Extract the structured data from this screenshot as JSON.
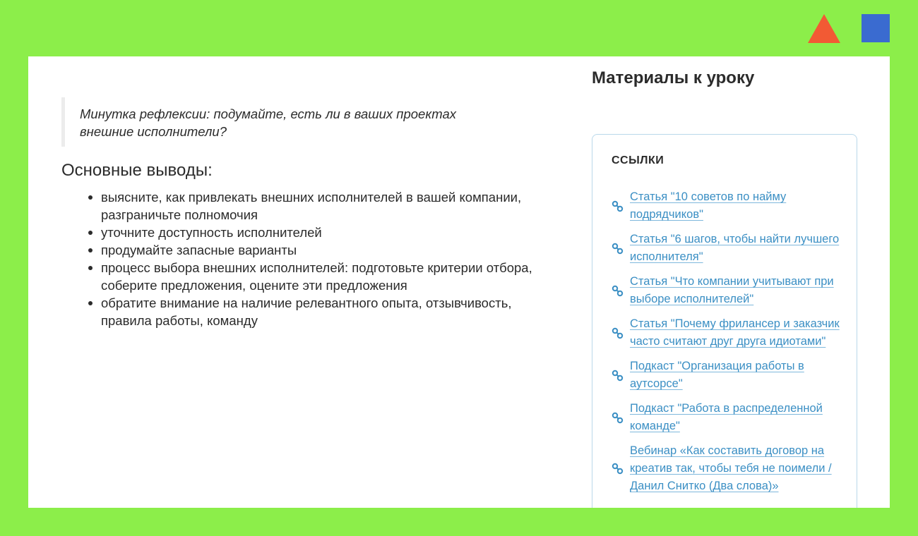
{
  "quote": {
    "text": "Минутка рефлексии: подумайте, есть ли в ваших проектах внешние исполнители?"
  },
  "conclusions": {
    "title": "Основные выводы:",
    "items": [
      "выясните, как привлекать внешних исполнителей в вашей компании, разграничьте полномочия",
      "уточните доступность исполнителей",
      "продумайте запасные варианты",
      "процесс выбора внешних исполнителей: подготовьте критерии отбора, соберите предложения, оцените эти предложения",
      "обратите внимание на наличие релевантного опыта, отзывчивость, правила работы, команду"
    ]
  },
  "sidebar": {
    "title": "Материалы к уроку",
    "links_heading": "ССЫЛКИ",
    "links": [
      "Статья \"10 советов по найму подрядчиков\"",
      "Статья \"6 шагов, чтобы найти лучшего исполнителя\"",
      "Статья \"Что компании учитывают при выборе исполнителей\"",
      "Статья \"Почему фрилансер и заказчик часто считают друг друга идиотами\"",
      "Подкаст \"Организация работы в аутсорсе\"",
      "Подкаст \"Работа в распределенной команде\"",
      "Вебинар «Как составить договор на креатив так, чтобы тебя не поимели / Данил Снитко (Два слова)»"
    ],
    "link_icon": "link-icon"
  },
  "colors": {
    "background": "#8cee4a",
    "link": "#3b8fc4",
    "deco_triangle": "#f25a34",
    "deco_square": "#3a6bd0"
  }
}
